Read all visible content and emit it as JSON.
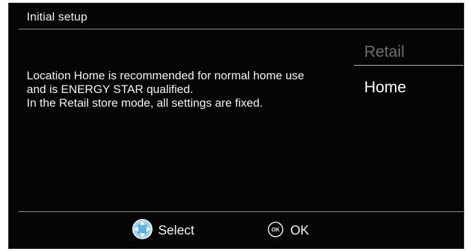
{
  "header": {
    "title": "Initial setup"
  },
  "description": {
    "line1": "Location Home is recommended for normal home use",
    "line2": "and is ENERGY STAR qualified.",
    "line3": "In the Retail store mode, all settings are fixed."
  },
  "options": {
    "retail": "Retail",
    "home": "Home",
    "selected": "Home"
  },
  "footer": {
    "select_label": "Select",
    "ok_label": "OK",
    "ok_icon_text": "OK"
  },
  "icons": {
    "select": "dpad-icon",
    "ok": "ok-button-icon"
  },
  "colors": {
    "background": "#050505",
    "text": "#f5f5f5",
    "dimmed_option": "#6e6e6e",
    "dpad_blue": "#7fc7ef"
  }
}
